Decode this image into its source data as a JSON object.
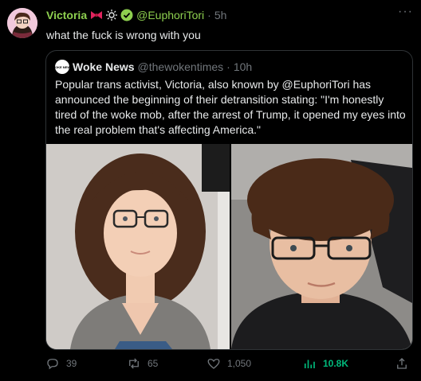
{
  "tweet": {
    "author_name": "Victoria",
    "author_handle": "@EuphoriTori",
    "separator": "·",
    "time": "5h",
    "text": "what the fuck is wrong with you",
    "more": "···",
    "name_color": "#8ed04f"
  },
  "quote": {
    "logo_text": "WOKE NEWS",
    "author_name": "Woke News",
    "author_handle": "@thewokentimes",
    "separator": "·",
    "time": "10h",
    "text": "Popular trans activist, Victoria, also known by @EuphoriTori has announced the beginning of their detransition stating: \"I'm honestly tired of the woke mob, after the arrest of Trump, it opened my eyes into the real problem that's affecting America.\""
  },
  "actions": {
    "replies": "39",
    "reposts": "65",
    "likes": "1,050",
    "views": "10.8K",
    "views_color": "#00ba7c"
  }
}
